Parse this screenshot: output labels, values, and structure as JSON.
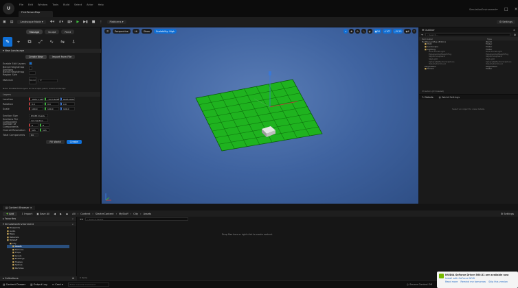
{
  "titlebar": {
    "menus": [
      "File",
      "Edit",
      "Window",
      "Tools",
      "Build",
      "Select",
      "Actor",
      "Help"
    ],
    "tab": "FirstPersonMap",
    "project": "SimulationEnvironment"
  },
  "toolbar": {
    "save_label": "",
    "mode_label": "Landscape Mode",
    "platforms_label": "Platforms",
    "settings_label": "Settings"
  },
  "leftpanel": {
    "mode_tabs": [
      "Manage",
      "Sculpt",
      "Paint"
    ],
    "tools": [
      "New",
      "Select",
      "Copy",
      "Resize",
      "Edit",
      "Mirror",
      "Import"
    ],
    "section": "New Landscape",
    "create_new": "Create New",
    "import_file": "Import from File",
    "props": [
      {
        "label": "Enable Edit Layers",
        "value": ""
      },
      {
        "label": "Blend Heightmap Sections",
        "value": ""
      },
      {
        "label": "Blend Heightmap Region Size",
        "value": ""
      },
      {
        "label": "Material",
        "value": "None"
      }
    ],
    "note": "Note: Enable Edit Layers to be sculpt, paint, build Landscape",
    "layers_label": "Layers",
    "transform": [
      {
        "label": "Location",
        "values": [
          "-6957.7910",
          "-7073.6293",
          "6605.0000"
        ]
      },
      {
        "label": "Rotation",
        "values": [
          "0.0",
          "0.0",
          "0.0"
        ]
      },
      {
        "label": "Scale",
        "values": [
          "100.0",
          "100.0",
          "100.0"
        ]
      }
    ],
    "params": [
      {
        "label": "Section Size",
        "value": "63x63 Quads"
      },
      {
        "label": "Sections Per Component",
        "value": "1x1 Section"
      },
      {
        "label": "Number of Components",
        "value": "8"
      },
      {
        "label": "Overall Resolution",
        "value": "505"
      },
      {
        "label": "Total Components",
        "value": "64"
      }
    ],
    "fill_world": "Fill World",
    "create_btn": "Create"
  },
  "viewport": {
    "perspective": "Perspective",
    "lit": "Lit",
    "show": "Show",
    "scalability": "Scalability: High",
    "right_tools": [
      "10",
      "10°",
      "0.25",
      "4"
    ]
  },
  "outliner": {
    "tab": "Outliner",
    "search_placeholder": "Search...",
    "header_label": "Item Label",
    "header_type": "Type",
    "items": [
      {
        "label": "FirstPersonMap (Editor)",
        "type": "World",
        "indent": 0
      },
      {
        "label": "HUD",
        "type": "Folder",
        "indent": 1
      },
      {
        "label": "Landscape",
        "type": "Folder",
        "indent": 1
      },
      {
        "label": "Lighting",
        "type": "Folder",
        "indent": 1
      },
      {
        "label": "DirectionalLight",
        "type": "DirectionalLight",
        "indent": 2
      },
      {
        "label": "ExponentialHeightFog",
        "type": "ExponentialHeightFog",
        "indent": 2
      },
      {
        "label": "SkyAtmosphere",
        "type": "SkyAtmosphere",
        "indent": 2
      },
      {
        "label": "SkyLight",
        "type": "SkyLight",
        "indent": 2
      },
      {
        "label": "SphereReflectionCapture",
        "type": "SphereReflectionCapture",
        "indent": 2
      },
      {
        "label": "VolumetricCloud",
        "type": "VolumetricCloud",
        "indent": 2
      },
      {
        "label": "PlayerStart",
        "type": "PlayerStart",
        "indent": 1
      },
      {
        "label": "Terrain",
        "type": "Folder",
        "indent": 1
      }
    ],
    "count": "33 actors (33 loaded)"
  },
  "details": {
    "tab": "Details",
    "world_tab": "World Settings",
    "empty": "Select an object to view details."
  },
  "content": {
    "tab": "Content Browser",
    "add": "Add",
    "import": "Import",
    "save_all": "Save All",
    "path": [
      "All",
      "Content",
      "StarterContent",
      "MyStuff",
      "City",
      "Assets"
    ],
    "settings": "Settings",
    "favorites": "Favorites",
    "project": "SimulationEnvironment",
    "search_placeholder": "Search Assets",
    "tree": [
      "Blueprints",
      "Audio",
      "Maps",
      "Materials",
      "MyStuff",
      "City",
      "Assets",
      "Textures",
      "Props",
      "Levels",
      "Buildings",
      "Shapes",
      "Splines",
      "Particles"
    ],
    "drop_text": "Drop files here or right click to create content.",
    "collections": "Collections",
    "items_label": "0 items"
  },
  "status": {
    "content_drawer": "Content Drawer",
    "output_log": "Output Log",
    "cmd": "Cmd",
    "console_placeholder": "Enter Console Command",
    "source_control": "Source Control Off"
  },
  "toast": {
    "title": "NVIDIA GeForce Driver 560.81 are available now",
    "subtitle": "Install with GeForce NOW",
    "link1": "Read more",
    "link2": "Remind me tomorrow",
    "link3": "Skip this version"
  },
  "colors": {
    "accent": "#0f6fd6",
    "landscape": "#1fb31f",
    "grid": "#0e6e0e",
    "viewport": "#4468a3"
  }
}
